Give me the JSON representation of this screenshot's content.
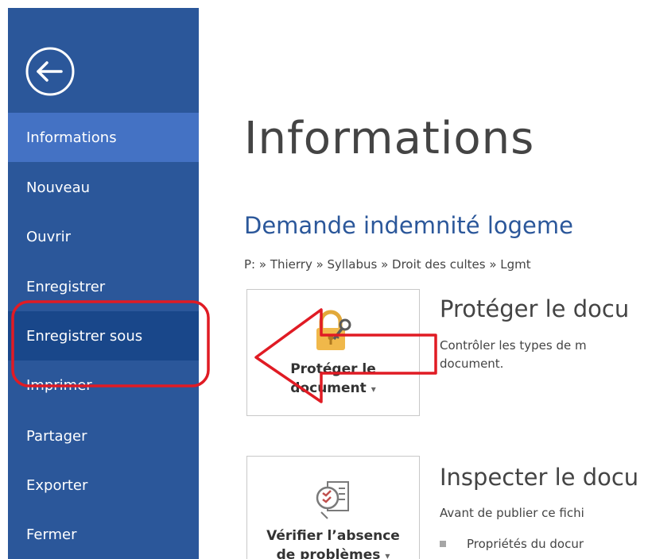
{
  "sidebar": {
    "items": [
      {
        "label": "Informations"
      },
      {
        "label": "Nouveau"
      },
      {
        "label": "Ouvrir"
      },
      {
        "label": "Enregistrer"
      },
      {
        "label": "Enregistrer sous"
      },
      {
        "label": "Imprimer"
      },
      {
        "label": "Partager"
      },
      {
        "label": "Exporter"
      },
      {
        "label": "Fermer"
      }
    ],
    "active_index": 0,
    "highlighted_index": 4
  },
  "main": {
    "title": "Informations",
    "document_name": "Demande indemnité logeme",
    "path": "P: » Thierry » Syllabus » Droit des cultes » Lgmt",
    "cards": [
      {
        "label_line1": "Protéger le",
        "label_line2": "document",
        "heading": "Protéger le docu",
        "description_line1": "Contrôler les types de m",
        "description_line2": "document."
      },
      {
        "label_line1": "Vérifier l’absence",
        "label_line2": "de problèmes",
        "heading": "Inspecter le docu",
        "description_line1": "Avant de publier ce fichi",
        "bullet": "Propriétés du docur"
      }
    ]
  },
  "icons": {
    "back": "back-arrow-icon",
    "protect": "lock-key-icon",
    "inspect": "checklist-inspect-icon",
    "dropdown": "caret-down-icon"
  },
  "colors": {
    "sidebar_bg": "#2b579a",
    "sidebar_active": "#4472c4",
    "sidebar_hover": "#19478a",
    "doc_name": "#2b579a",
    "annotation_red": "#e01b24"
  }
}
